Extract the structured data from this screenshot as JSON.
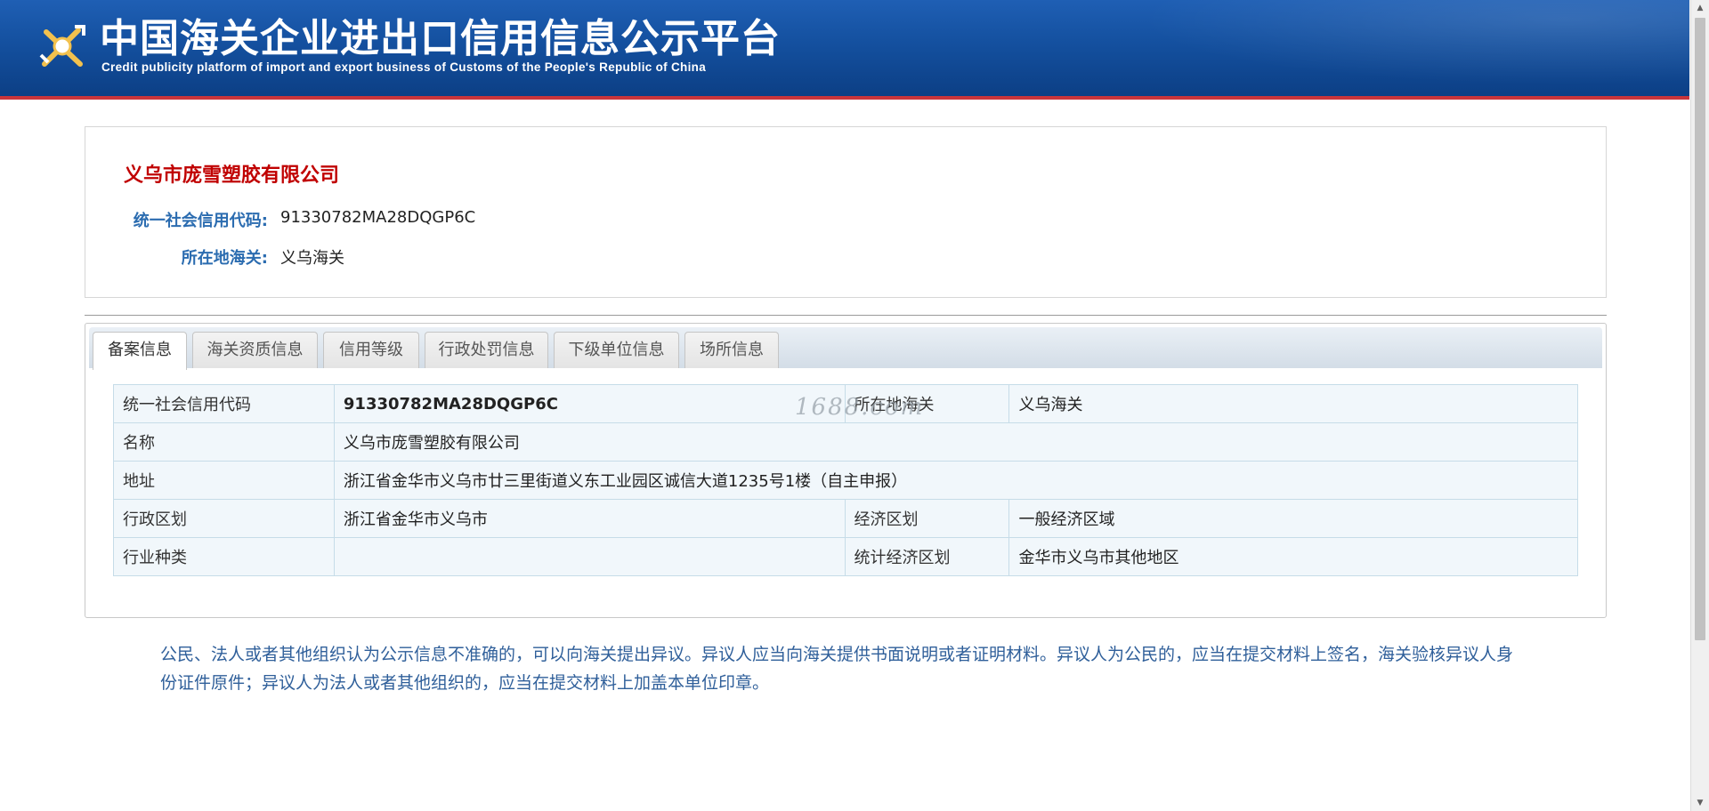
{
  "header": {
    "title": "中国海关企业进出口信用信息公示平台",
    "subtitle": "Credit publicity platform of import and export business of Customs of the People's Republic of China",
    "logo_icon": "customs-emblem-icon"
  },
  "company": {
    "name": "义乌市庞雪塑胶有限公司",
    "credit_code_label": "统一社会信用代码:",
    "credit_code": "91330782MA28DQGP6C",
    "customs_label": "所在地海关:",
    "customs": "义乌海关"
  },
  "tabs": [
    {
      "label": "备案信息",
      "active": true
    },
    {
      "label": "海关资质信息",
      "active": false
    },
    {
      "label": "信用等级",
      "active": false
    },
    {
      "label": "行政处罚信息",
      "active": false
    },
    {
      "label": "下级单位信息",
      "active": false
    },
    {
      "label": "场所信息",
      "active": false
    }
  ],
  "record": {
    "credit_code_label": "统一社会信用代码",
    "credit_code": "91330782MA28DQGP6C",
    "customs_label": "所在地海关",
    "customs": "义乌海关",
    "name_label": "名称",
    "name": "义乌市庞雪塑胶有限公司",
    "address_label": "地址",
    "address": "浙江省金华市义乌市廿三里街道义东工业园区诚信大道1235号1楼（自主申报）",
    "admin_region_label": "行政区划",
    "admin_region": "浙江省金华市义乌市",
    "econ_region_label": "经济区划",
    "econ_region": "一般经济区域",
    "industry_label": "行业种类",
    "industry": "",
    "stat_region_label": "统计经济区划",
    "stat_region": "金华市义乌市其他地区"
  },
  "watermark": "1688.com",
  "notice": "公民、法人或者其他组织认为公示信息不准确的，可以向海关提出异议。异议人应当向海关提供书面说明或者证明材料。异议人为公民的，应当在提交材料上签名，海关验核异议人身份证件原件；异议人为法人或者其他组织的，应当在提交材料上加盖本单位印章。",
  "colors": {
    "banner": "#14509f",
    "banner_border": "#c9353b",
    "company_name": "#c00000",
    "label_blue": "#2b6cb0",
    "notice_text": "#2f5f9a"
  }
}
